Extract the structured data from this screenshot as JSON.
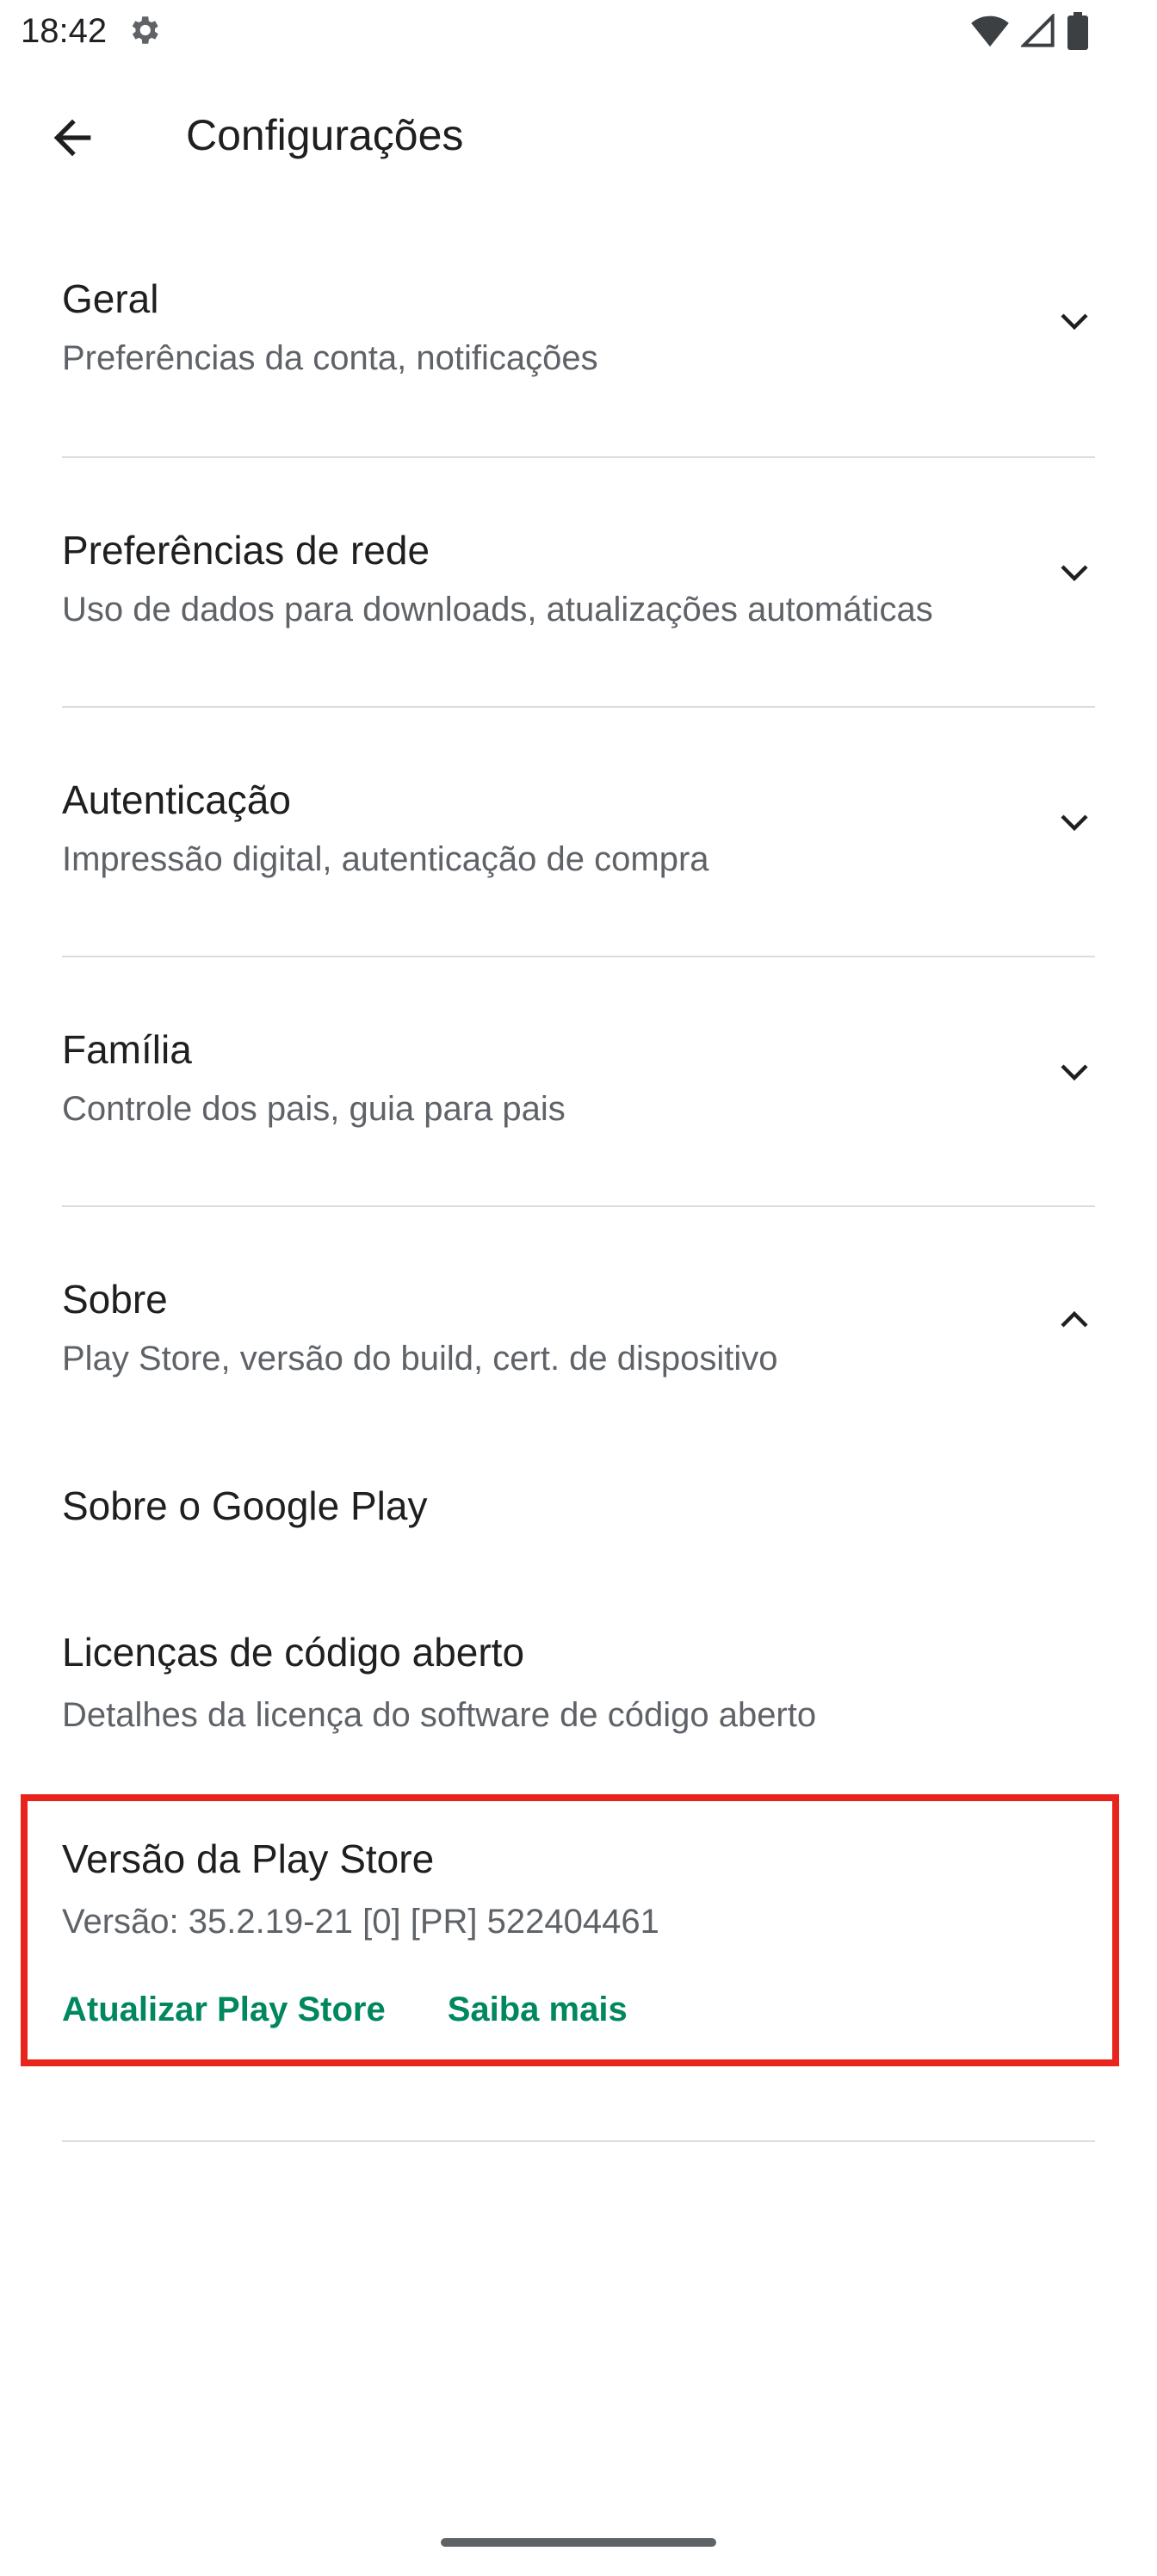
{
  "status_bar": {
    "time": "18:42",
    "settings_icon": "gear-icon",
    "icons": [
      "wifi-icon",
      "signal-icon",
      "battery-icon"
    ]
  },
  "app_bar": {
    "title": "Configurações",
    "back_icon": "arrow-back-icon"
  },
  "sections": [
    {
      "title": "Geral",
      "subtitle": "Preferências da conta, notificações",
      "expanded": false
    },
    {
      "title": "Preferências de rede",
      "subtitle": "Uso de dados para downloads, atualizações automáticas",
      "expanded": false
    },
    {
      "title": "Autenticação",
      "subtitle": "Impressão digital, autenticação de compra",
      "expanded": false
    },
    {
      "title": "Família",
      "subtitle": "Controle dos pais, guia para pais",
      "expanded": false
    },
    {
      "title": "Sobre",
      "subtitle": "Play Store, versão do build, cert. de dispositivo",
      "expanded": true
    }
  ],
  "about": {
    "about_google_play": "Sobre o Google Play",
    "licenses": {
      "title": "Licenças de código aberto",
      "subtitle": "Detalhes da licença do software de código aberto"
    },
    "version": {
      "title": "Versão da Play Store",
      "value": "Versão: 35.2.19-21 [0] [PR] 522404461",
      "update_link": "Atualizar Play Store",
      "learn_more_link": "Saiba mais"
    }
  },
  "colors": {
    "accent": "#01875f",
    "highlight": "#e8241c",
    "divider": "#dadce0",
    "secondary_text": "#5f6368"
  }
}
